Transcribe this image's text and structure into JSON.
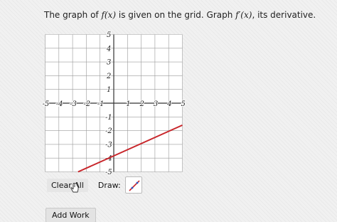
{
  "question": {
    "prefix": "The graph of ",
    "func": "f(x)",
    "middle": " is given on the grid. Graph ",
    "deriv": "f′(x)",
    "suffix": ", its derivative."
  },
  "graph": {
    "x_ticks": [
      "-5",
      "-4",
      "-3",
      "-2",
      "-1",
      "1",
      "2",
      "3",
      "4",
      "5"
    ],
    "y_ticks": [
      "5",
      "4",
      "3",
      "2",
      "1",
      "-1",
      "-2",
      "-3",
      "-4",
      "-5"
    ],
    "line_color": "#c8262b",
    "line": {
      "x1": -2.6,
      "y1": -5.0,
      "x2": 5.0,
      "y2": -1.6
    }
  },
  "toolbar": {
    "clear_label": "Clear All",
    "draw_label": "Draw:",
    "draw_tool_icon": "line-tool-icon",
    "cursor_icon": "hand-cursor-icon"
  },
  "add_work_label": "Add Work"
}
